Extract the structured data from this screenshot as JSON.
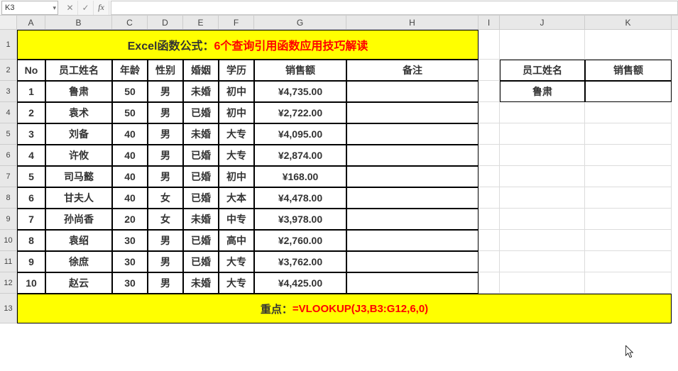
{
  "namebox": "K3",
  "formula": "",
  "columns": [
    "A",
    "B",
    "C",
    "D",
    "E",
    "F",
    "G",
    "H",
    "I",
    "J",
    "K"
  ],
  "title": {
    "black": "Excel函数公式：",
    "red": "6个查询引用函数应用技巧解读"
  },
  "headers": {
    "no": "No",
    "name": "员工姓名",
    "age": "年龄",
    "gender": "性别",
    "marriage": "婚姻",
    "edu": "学历",
    "sales": "销售额",
    "note": "备注",
    "lname": "员工姓名",
    "lsales": "销售额"
  },
  "rows": [
    {
      "no": "1",
      "name": "鲁肃",
      "age": "50",
      "gender": "男",
      "marriage": "未婚",
      "edu": "初中",
      "sales": "¥4,735.00"
    },
    {
      "no": "2",
      "name": "袁术",
      "age": "50",
      "gender": "男",
      "marriage": "已婚",
      "edu": "初中",
      "sales": "¥2,722.00"
    },
    {
      "no": "3",
      "name": "刘备",
      "age": "40",
      "gender": "男",
      "marriage": "未婚",
      "edu": "大专",
      "sales": "¥4,095.00"
    },
    {
      "no": "4",
      "name": "许攸",
      "age": "40",
      "gender": "男",
      "marriage": "已婚",
      "edu": "大专",
      "sales": "¥2,874.00"
    },
    {
      "no": "5",
      "name": "司马懿",
      "age": "40",
      "gender": "男",
      "marriage": "已婚",
      "edu": "初中",
      "sales": "¥168.00"
    },
    {
      "no": "6",
      "name": "甘夫人",
      "age": "40",
      "gender": "女",
      "marriage": "已婚",
      "edu": "大本",
      "sales": "¥4,478.00"
    },
    {
      "no": "7",
      "name": "孙尚香",
      "age": "20",
      "gender": "女",
      "marriage": "未婚",
      "edu": "中专",
      "sales": "¥3,978.00"
    },
    {
      "no": "8",
      "name": "袁绍",
      "age": "30",
      "gender": "男",
      "marriage": "已婚",
      "edu": "高中",
      "sales": "¥2,760.00"
    },
    {
      "no": "9",
      "name": "徐庶",
      "age": "30",
      "gender": "男",
      "marriage": "已婚",
      "edu": "大专",
      "sales": "¥3,762.00"
    },
    {
      "no": "10",
      "name": "赵云",
      "age": "30",
      "gender": "男",
      "marriage": "未婚",
      "edu": "大专",
      "sales": "¥4,425.00"
    }
  ],
  "lookup": {
    "name": "鲁肃",
    "sales": ""
  },
  "footer": {
    "black": "重点：",
    "red": "=VLOOKUP(J3,B3:G12,6,0)"
  },
  "row_heights": {
    "title": 42,
    "header": 30,
    "data": 30,
    "footer": 42
  }
}
